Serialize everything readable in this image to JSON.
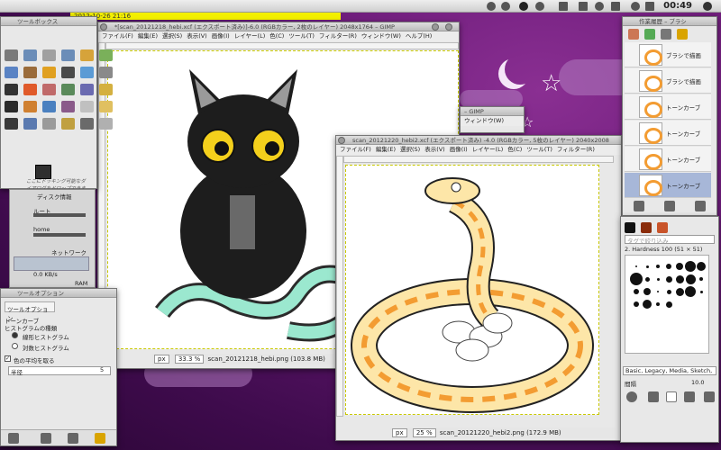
{
  "top_panel": {
    "datetime": "2012-10-26 21:16",
    "clock": "00:49"
  },
  "toolbox": {
    "title": "ツールボックス",
    "drop_hint": "ここにドッキング可能なダイアログをドロップできます"
  },
  "system_monitor": {
    "disk_title": "ディスク情報",
    "disk_root": "ルート",
    "disk_home": "home",
    "network_title": "ネットワーク",
    "network_speed": "0.0 KB/s",
    "network_speed2": "0.0 KB/s",
    "ram_title": "RAM"
  },
  "tool_options": {
    "window_title": "ツールオプション",
    "tab_label": "ツールオプション",
    "tool_name": "トーンカーブ",
    "histogram_label": "ヒストグラムの種類",
    "radio_linear": "線形ヒストグラム",
    "radio_log": "対数ヒストグラム",
    "checkbox_average": "色の平均を取る",
    "dropdown_value": "半径",
    "spin_value": "5"
  },
  "image_window_1": {
    "title": "*[scan_20121218_hebi.xcf (エクスポート済み)]-6.0 (RGBカラー, 2枚のレイヤー) 2048x1764 – GIMP",
    "menus": [
      "ファイル(F)",
      "編集(E)",
      "選択(S)",
      "表示(V)",
      "画像(I)",
      "レイヤー(L)",
      "色(C)",
      "ツール(T)",
      "フィルター(R)",
      "ウィンドウ(W)",
      "ヘルプ(H)"
    ],
    "unit": "px",
    "zoom": "33.3 %",
    "status": "scan_20121218_hebi.png (103.8 MB)"
  },
  "mini_window": {
    "title": "– GIMP",
    "menu": "ウィンドウ(W)"
  },
  "image_window_2": {
    "title": "scan_20121220_hebi2.xcf (エクスポート済み) -4.0 (RGBカラー, 5枚のレイヤー) 2040x2008",
    "menus": [
      "ファイル(F)",
      "編集(E)",
      "選択(S)",
      "表示(V)",
      "画像(I)",
      "レイヤー(L)",
      "色(C)",
      "ツール(T)",
      "フィルター(R)"
    ],
    "unit": "px",
    "zoom": "25 %",
    "status": "scan_20121220_hebi2.png (172.9 MB)"
  },
  "layers_panel": {
    "title": "作業履歴 – ブラシ",
    "layers": [
      {
        "name": "ブラシで描画"
      },
      {
        "name": "ブラシで描画"
      },
      {
        "name": "トーンカーブ"
      },
      {
        "name": "トーンカーブ"
      },
      {
        "name": "トーンカーブ"
      },
      {
        "name": "トーンカーブ"
      }
    ]
  },
  "brushes_panel": {
    "filter_placeholder": "タグで絞り込み",
    "brush_info": "2. Hardness 100 (51 × 51)",
    "tag_value": "Basic, Legacy, Media, Sketch, ",
    "spacing_label": "間隔",
    "spacing_value": "10.0"
  },
  "colors": {
    "fg": "#2f2f2f",
    "bg": "#e8421f",
    "accent_orange": "#f39c32",
    "cat_eye": "#f4d01c",
    "snake_fill": "#fde6a8",
    "green_snake": "#9be8cf",
    "selection_blue": "#a7b7d8"
  }
}
